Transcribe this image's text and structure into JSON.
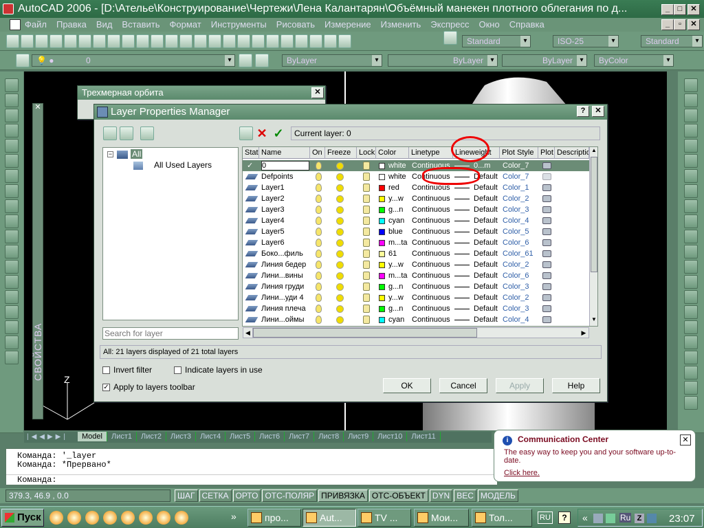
{
  "window": {
    "title": "AutoCAD 2006 - [D:\\Ателье\\Конструирование\\Чертежи\\Лена Калантарян\\Объёмный манекен плотного облегания по д..."
  },
  "menu": [
    "Файл",
    "Правка",
    "Вид",
    "Вставить",
    "Формат",
    "Инструменты",
    "Рисовать",
    "Измерение",
    "Изменить",
    "Экспресс",
    "Окно",
    "Справка"
  ],
  "toolbar": {
    "text_style": "Standard",
    "dim_style": "ISO-25",
    "table_style": "Standard",
    "layer_value": "0",
    "color": "ByLayer",
    "linetype": "ByLayer",
    "lineweight": "ByLayer",
    "plotstyle": "ByColor"
  },
  "orbit_dialog": {
    "title": "Трехмерная орбита"
  },
  "properties_palette": {
    "label": "СВОЙСТВА"
  },
  "dialog": {
    "title": "Layer Properties Manager",
    "current_layer": "Current layer: 0",
    "tree": {
      "all": "All",
      "all_used": "All Used Layers"
    },
    "search_placeholder": "Search for layer",
    "summary": "All: 21 layers displayed of 21 total layers",
    "invert_filter": "Invert filter",
    "indicate_in_use": "Indicate layers in use",
    "apply_toolbar": "Apply to layers toolbar",
    "ok": "OK",
    "cancel": "Cancel",
    "apply": "Apply",
    "help": "Help",
    "help_q": "?",
    "columns": [
      "Stat",
      "Name",
      "On",
      "Freeze",
      "Lock",
      "Color",
      "Linetype",
      "Lineweight",
      "Plot Style",
      "Plot",
      "Descriptio"
    ],
    "layers": [
      {
        "name": "0",
        "color": "white",
        "swatch": "#ffffff",
        "linetype": "Continuous",
        "lineweight": "0...m",
        "plotstyle": "Color_7",
        "selected": true
      },
      {
        "name": "Defpoints",
        "color": "white",
        "swatch": "#ffffff",
        "linetype": "Continuous",
        "lineweight": "Default",
        "plotstyle": "Color_7"
      },
      {
        "name": "Layer1",
        "color": "red",
        "swatch": "#ff0000",
        "linetype": "Continuous",
        "lineweight": "Default",
        "plotstyle": "Color_1"
      },
      {
        "name": "Layer2",
        "color": "y...w",
        "swatch": "#ffff00",
        "linetype": "Continuous",
        "lineweight": "Default",
        "plotstyle": "Color_2"
      },
      {
        "name": "Layer3",
        "color": "g...n",
        "swatch": "#00ff00",
        "linetype": "Continuous",
        "lineweight": "Default",
        "plotstyle": "Color_3"
      },
      {
        "name": "Layer4",
        "color": "cyan",
        "swatch": "#00ffff",
        "linetype": "Continuous",
        "lineweight": "Default",
        "plotstyle": "Color_4"
      },
      {
        "name": "Layer5",
        "color": "blue",
        "swatch": "#0000ff",
        "linetype": "Continuous",
        "lineweight": "Default",
        "plotstyle": "Color_5"
      },
      {
        "name": "Layer6",
        "color": "m...ta",
        "swatch": "#ff00ff",
        "linetype": "Continuous",
        "lineweight": "Default",
        "plotstyle": "Color_6"
      },
      {
        "name": "Боко...филь",
        "color": "61",
        "swatch": "#ffff99",
        "linetype": "Continuous",
        "lineweight": "Default",
        "plotstyle": "Color_61"
      },
      {
        "name": "Линия бедер",
        "color": "y...w",
        "swatch": "#ffff00",
        "linetype": "Continuous",
        "lineweight": "Default",
        "plotstyle": "Color_2"
      },
      {
        "name": "Лини...вины",
        "color": "m...ta",
        "swatch": "#ff00ff",
        "linetype": "Continuous",
        "lineweight": "Default",
        "plotstyle": "Color_6"
      },
      {
        "name": "Линия груди",
        "color": "g...n",
        "swatch": "#00ff00",
        "linetype": "Continuous",
        "lineweight": "Default",
        "plotstyle": "Color_3"
      },
      {
        "name": "Лини...уди 4",
        "color": "y...w",
        "swatch": "#ffff00",
        "linetype": "Continuous",
        "lineweight": "Default",
        "plotstyle": "Color_2"
      },
      {
        "name": "Линия плеча",
        "color": "g...n",
        "swatch": "#00ff00",
        "linetype": "Continuous",
        "lineweight": "Default",
        "plotstyle": "Color_3"
      },
      {
        "name": "Лини...оймы",
        "color": "cyan",
        "swatch": "#00ffff",
        "linetype": "Continuous",
        "lineweight": "Default",
        "plotstyle": "Color_4"
      }
    ]
  },
  "tabs": [
    "Model",
    "Лист1",
    "Лист2",
    "Лист3",
    "Лист4",
    "Лист5",
    "Лист6",
    "Лист7",
    "Лист8",
    "Лист9",
    "Лист10",
    "Лист11"
  ],
  "command": {
    "line1": "Команда:  '_layer",
    "line2": "Команда: *Прервано*",
    "prompt": "Команда:"
  },
  "status": {
    "coords": "379.3, 46.9 , 0.0",
    "buttons": [
      "ШАГ",
      "СЕТКА",
      "ОРТО",
      "ОТС-ПОЛЯР",
      "ПРИВЯЗКА",
      "ОТС-ОБЪЕКТ",
      "DYN",
      "ВЕС",
      "МОДЕЛЬ"
    ]
  },
  "comm_center": {
    "title": "Communication Center",
    "body": "The easy way to keep you and your software up-to-date.",
    "link": "Click here."
  },
  "taskbar": {
    "start": "Пуск",
    "more": "»",
    "tasks": [
      "про...",
      "Aut...",
      "TV ...",
      "Мои...",
      "Тол..."
    ],
    "lang": "RU",
    "tray_lang": "Ru",
    "tray_more": "«",
    "help": "?",
    "clock": "23:07"
  },
  "axis": {
    "z": "Z"
  }
}
